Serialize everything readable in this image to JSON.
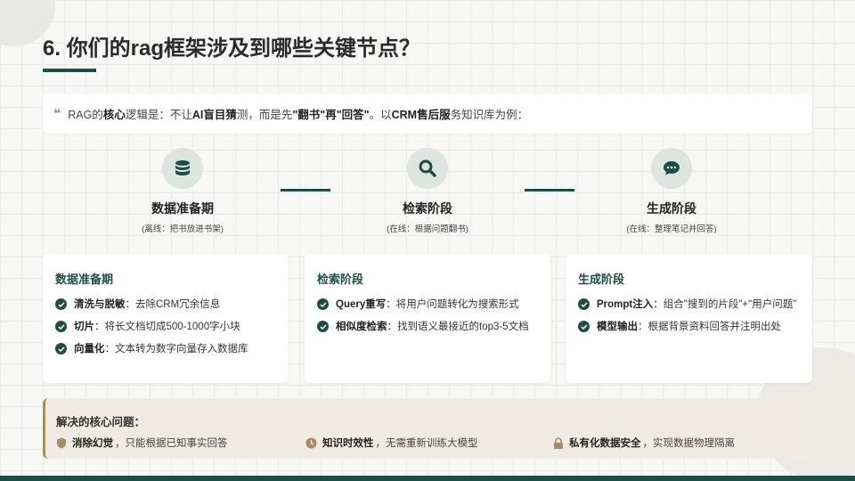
{
  "title": "6. 你们的rag框架涉及到哪些关键节点？",
  "intro": {
    "p1": "RAG的",
    "b1": "核心",
    "p2": "逻辑是：不让",
    "b2": "AI盲目猜",
    "p3": "测，而是先",
    "b3": "\"翻书\"再\"回答\"",
    "p4": "。以",
    "b4": "CRM售后服",
    "p5": "务知识库为例："
  },
  "stages": [
    {
      "name": "数据准备期",
      "sub": "(离线：把书放进书架)",
      "icon": "database-icon"
    },
    {
      "name": "检索阶段",
      "sub": "(在线：根据问题翻书)",
      "icon": "search-icon"
    },
    {
      "name": "生成阶段",
      "sub": "(在线：整理笔记并回答)",
      "icon": "chat-icon"
    }
  ],
  "cards": [
    {
      "title": "数据准备期",
      "items": [
        {
          "bold": "清洗与脱敏",
          "text": "：去除CRM冗余信息"
        },
        {
          "bold": "切片",
          "text": "：将长文档切成500-1000字小块"
        },
        {
          "bold": "向量化",
          "text": "：文本转为数字向量存入数据库"
        }
      ]
    },
    {
      "title": "检索阶段",
      "items": [
        {
          "bold": "Query重写",
          "text": "：将用户问题转化为搜索形式"
        },
        {
          "bold": "相似度检索",
          "text": "：找到语义最接近的top3-5文档"
        }
      ]
    },
    {
      "title": "生成阶段",
      "items": [
        {
          "bold": "Prompt注入",
          "text": "：组合\"搜到的片段\"+\"用户问题\""
        },
        {
          "bold": "模型输出",
          "text": "：根据背景资料回答并注明出处"
        }
      ]
    }
  ],
  "bottom": {
    "title": "解决的核心问题：",
    "points": [
      {
        "bold": "消除幻觉",
        "text": "，只能根据已知事实回答",
        "icon": "shield-icon"
      },
      {
        "bold": "知识时效性",
        "text": "，无需重新训练大模型",
        "icon": "clock-icon"
      },
      {
        "bold": "私有化数据安全",
        "text": "，实现数据物理隔离",
        "icon": "lock-icon"
      }
    ]
  },
  "colors": {
    "primary": "#1e4d43",
    "accent": "#a88d5e"
  }
}
